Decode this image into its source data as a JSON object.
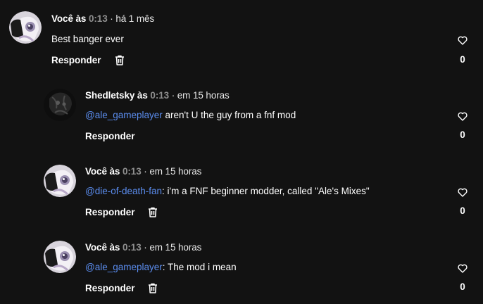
{
  "comments": [
    {
      "author": "Você às",
      "timestamp": "0:13",
      "ago": "· há 1 mês",
      "mention": "",
      "text": "Best banger ever",
      "reply_label": "Responder",
      "likes": "0",
      "avatar": "user-avatar-white"
    },
    {
      "author": "Shedletsky às",
      "timestamp": "0:13",
      "ago": "· em 15 horas",
      "mention": "@ale_gameplayer",
      "text": " aren't U the guy from a fnf mod",
      "reply_label": "Responder",
      "likes": "0",
      "avatar": "user-avatar-dark"
    },
    {
      "author": "Você às",
      "timestamp": "0:13",
      "ago": "· em 15 horas",
      "mention": "@die-of-death-fan",
      "text": ": i'm a FNF beginner modder, called \"Ale's Mixes\"",
      "reply_label": "Responder",
      "likes": "0",
      "avatar": "user-avatar-white"
    },
    {
      "author": "Você às",
      "timestamp": "0:13",
      "ago": "· em 15 horas",
      "mention": "@ale_gameplayer",
      "text": ": The mod i mean",
      "reply_label": "Responder",
      "likes": "0",
      "avatar": "user-avatar-white"
    }
  ],
  "colors": {
    "background": "#121212",
    "mention": "#5b8def",
    "timestamp": "#8f8f8f"
  }
}
